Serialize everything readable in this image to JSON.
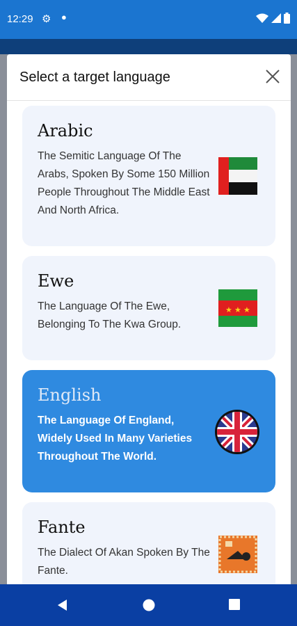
{
  "status_bar": {
    "time": "12:29"
  },
  "dialog": {
    "title": "Select a target language"
  },
  "languages": [
    {
      "name": "Arabic",
      "description": "The Semitic Language Of The Arabs, Spoken By Some 150 Million People Throughout The Middle East And North Africa.",
      "flag_icon": "uae-flag-icon",
      "selected": false
    },
    {
      "name": "Ewe",
      "description": "The Language Of The Ewe, Belonging To The Kwa Group.",
      "flag_icon": "ewe-flag-icon",
      "selected": false
    },
    {
      "name": "English",
      "description": "The Language Of England, Widely Used In Many Varieties Throughout The World.",
      "flag_icon": "uk-flag-icon",
      "selected": true
    },
    {
      "name": "Fante",
      "description": "The Dialect Of Akan Spoken By The Fante.",
      "flag_icon": "fante-flag-icon",
      "selected": false
    }
  ],
  "colors": {
    "status_bar": "#1b75d0",
    "card": "#f0f4fc",
    "selected_card": "#2f8ae0",
    "nav_bar": "#0a3fa3"
  }
}
